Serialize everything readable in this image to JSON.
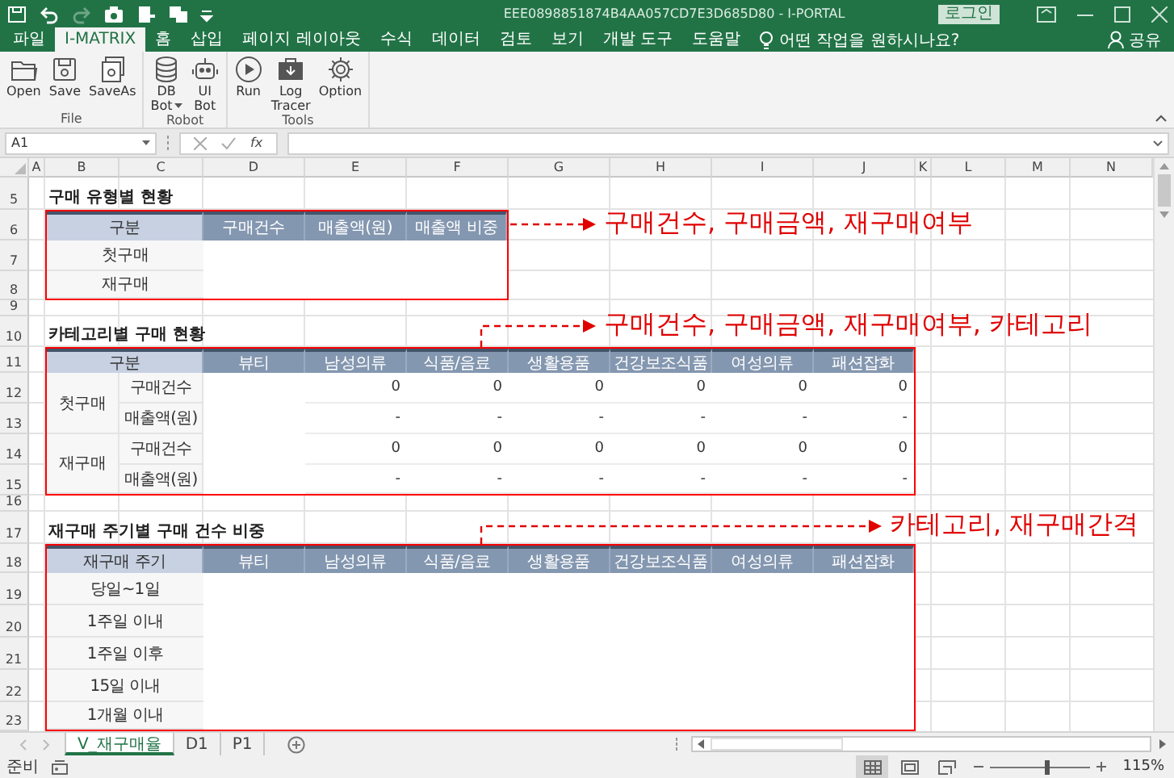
{
  "window": {
    "title": "EEE0898851874B4AA057CD7E3D685D80  -  I-PORTAL",
    "login_button": "로그인"
  },
  "quick_access": [
    {
      "kind": "save",
      "disabled": false
    },
    {
      "kind": "undo",
      "disabled": false
    },
    {
      "kind": "redo",
      "disabled": true
    },
    {
      "kind": "camera",
      "disabled": false
    },
    {
      "kind": "document",
      "disabled": false
    },
    {
      "kind": "copy",
      "disabled": false
    }
  ],
  "menu_tabs": [
    {
      "label": "파일",
      "selected": false
    },
    {
      "label": "I-MATRIX",
      "selected": true
    },
    {
      "label": "홈",
      "selected": false
    },
    {
      "label": "삽입",
      "selected": false
    },
    {
      "label": "페이지 레이아웃",
      "selected": false
    },
    {
      "label": "수식",
      "selected": false
    },
    {
      "label": "데이터",
      "selected": false
    },
    {
      "label": "검토",
      "selected": false
    },
    {
      "label": "보기",
      "selected": false
    },
    {
      "label": "개발 도구",
      "selected": false
    },
    {
      "label": "도움말",
      "selected": false
    }
  ],
  "tell_me": "어떤 작업을 원하시나요?",
  "share": "공유",
  "ribbon_groups": [
    {
      "label": "File",
      "buttons": [
        {
          "kind": "open",
          "lines": [
            "Open"
          ],
          "dropdown": false
        },
        {
          "kind": "save",
          "lines": [
            "Save"
          ],
          "dropdown": false
        },
        {
          "kind": "save-as",
          "lines": [
            "SaveAs"
          ],
          "dropdown": false
        }
      ]
    },
    {
      "label": "Robot",
      "buttons": [
        {
          "kind": "database",
          "lines": [
            "DB",
            "Bot"
          ],
          "dropdown": true
        },
        {
          "kind": "robot",
          "lines": [
            "UI",
            "Bot"
          ],
          "dropdown": false
        }
      ]
    },
    {
      "label": "Tools",
      "buttons": [
        {
          "kind": "run",
          "lines": [
            "Run"
          ],
          "dropdown": false
        },
        {
          "kind": "log",
          "lines": [
            "Log",
            "Tracer"
          ],
          "dropdown": false
        },
        {
          "kind": "settings",
          "lines": [
            "Option"
          ],
          "dropdown": false
        }
      ]
    }
  ],
  "formula_bar": {
    "name_box": "A1",
    "function_label": "fx"
  },
  "columns": [
    "A",
    "B",
    "C",
    "D",
    "E",
    "F",
    "G",
    "H",
    "I",
    "J",
    "K",
    "L",
    "M",
    "N"
  ],
  "row_numbers": [
    "5",
    "6",
    "7",
    "8",
    "9",
    "10",
    "11",
    "12",
    "13",
    "14",
    "15",
    "16",
    "17",
    "18",
    "19",
    "20",
    "21",
    "22",
    "23"
  ],
  "sections": [
    {
      "title": "구매 유형별 현황",
      "table": {
        "columns": [
          "구분",
          "구매건수",
          "매출액(원)",
          "매출액 비중"
        ],
        "rows": [
          {
            "label": "첫구매"
          },
          {
            "label": "재구매"
          }
        ]
      }
    },
    {
      "title": "카테고리별 구매 현황",
      "table": {
        "columns": [
          "구분",
          "뷰티",
          "남성의류",
          "식품/음료",
          "생활용품",
          "건강보조식품",
          "여성의류",
          "패션잡화"
        ],
        "groups": [
          {
            "label": "첫구매",
            "rows": [
              {
                "label": "구매건수",
                "values": [
                  "0",
                  "0",
                  "0",
                  "0",
                  "0",
                  "0"
                ]
              },
              {
                "label": "매출액(원)",
                "values": [
                  "-",
                  "-",
                  "-",
                  "-",
                  "-",
                  "-"
                ]
              }
            ]
          },
          {
            "label": "재구매",
            "rows": [
              {
                "label": "구매건수",
                "values": [
                  "0",
                  "0",
                  "0",
                  "0",
                  "0",
                  "0"
                ]
              },
              {
                "label": "매출액(원)",
                "values": [
                  "-",
                  "-",
                  "-",
                  "-",
                  "-",
                  "-"
                ]
              }
            ]
          }
        ]
      }
    },
    {
      "title": "재구매 주기별 구매 건수 비중",
      "table": {
        "columns": [
          "재구매 주기",
          "뷰티",
          "남성의류",
          "식품/음료",
          "생활용품",
          "건강보조식품",
          "여성의류",
          "패션잡화"
        ],
        "rows": [
          {
            "label": "당일~1일"
          },
          {
            "label": "1주일 이내"
          },
          {
            "label": "1주일 이후"
          },
          {
            "label": "15일 이내"
          },
          {
            "label": "1개월 이내"
          }
        ]
      }
    }
  ],
  "annotations": [
    {
      "text": "구매건수, 구매금액, 재구매여부"
    },
    {
      "text": "구매건수, 구매금액, 재구매여부, 카테고리"
    },
    {
      "text": "카테고리, 재구매간격"
    }
  ],
  "sheet_tabs": [
    {
      "label": "V_재구매율",
      "selected": true
    },
    {
      "label": "D1",
      "selected": false
    },
    {
      "label": "P1",
      "selected": false
    }
  ],
  "status_bar": {
    "text": "준비",
    "views": [
      {
        "kind": "normal",
        "selected": true
      },
      {
        "kind": "page-layout",
        "selected": false
      },
      {
        "kind": "page-break",
        "selected": false
      }
    ],
    "zoom": {
      "level": 0.56,
      "reading": "115%"
    }
  }
}
